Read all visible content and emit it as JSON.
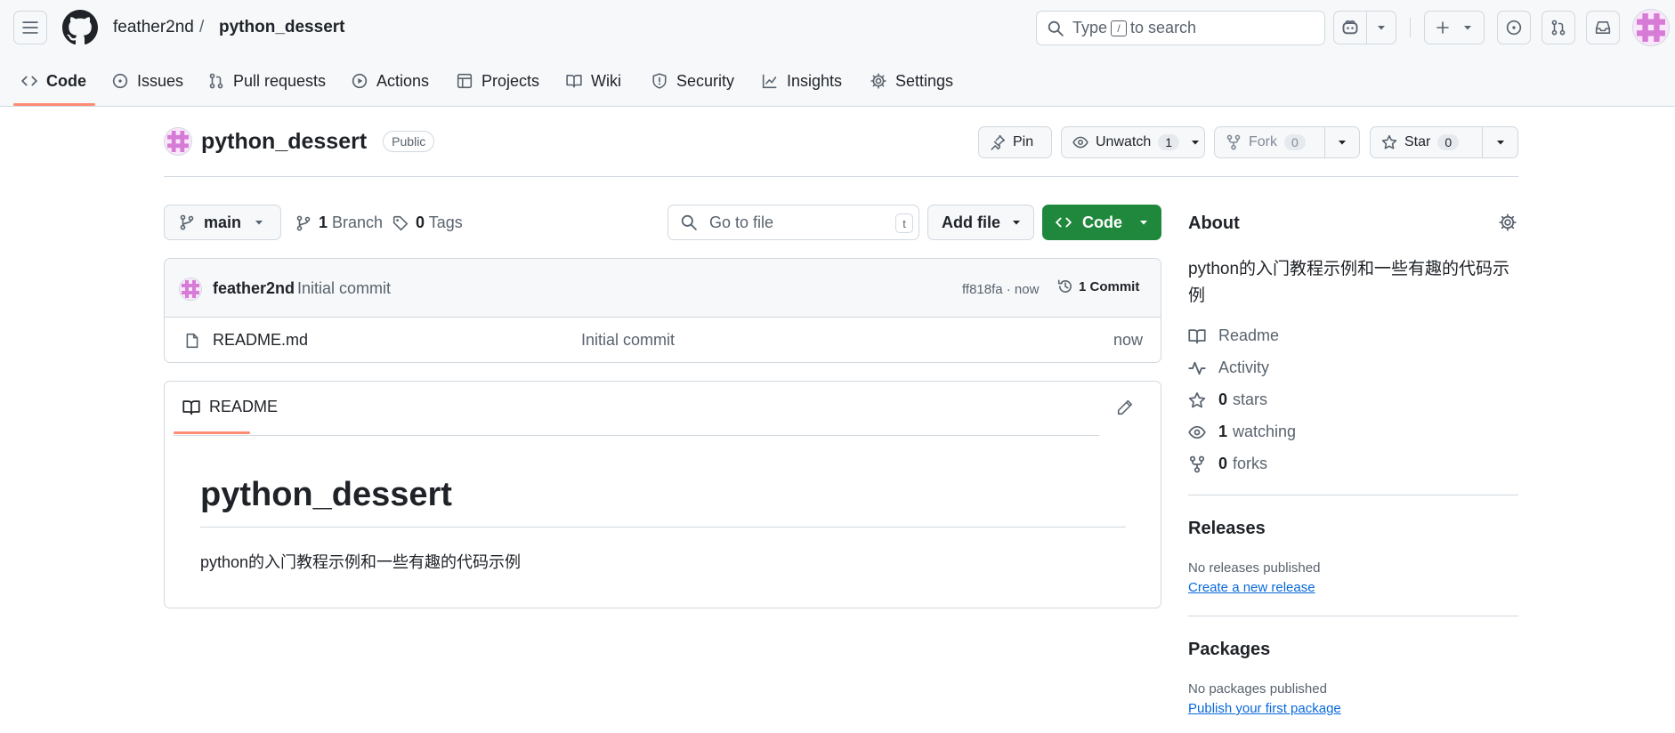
{
  "header": {
    "owner": "feather2nd",
    "separator": "/",
    "repo": "python_dessert",
    "search": {
      "prefix": "Type",
      "key": "/",
      "suffix": "to search"
    }
  },
  "tabs": [
    {
      "label": "Code",
      "icon": "code-icon",
      "active": true
    },
    {
      "label": "Issues",
      "icon": "issue-icon"
    },
    {
      "label": "Pull requests",
      "icon": "pull-request-icon"
    },
    {
      "label": "Actions",
      "icon": "play-icon"
    },
    {
      "label": "Projects",
      "icon": "table-icon"
    },
    {
      "label": "Wiki",
      "icon": "book-icon"
    },
    {
      "label": "Security",
      "icon": "shield-icon"
    },
    {
      "label": "Insights",
      "icon": "graph-icon"
    },
    {
      "label": "Settings",
      "icon": "gear-icon"
    }
  ],
  "repo_header": {
    "name": "python_dessert",
    "visibility": "Public",
    "pin": "Pin",
    "unwatch": "Unwatch",
    "watch_count": "1",
    "fork": "Fork",
    "fork_count": "0",
    "star": "Star",
    "star_count": "0"
  },
  "toolbar": {
    "branch": "main",
    "branch_count": "1",
    "branch_label": "Branch",
    "tag_count": "0",
    "tag_label": "Tags",
    "goto_placeholder": "Go to file",
    "goto_key": "t",
    "add_file": "Add file",
    "code": "Code"
  },
  "commit": {
    "author": "feather2nd",
    "message": "Initial commit",
    "hash_time": "ff818fa · now",
    "commits": "1 Commit"
  },
  "files": [
    {
      "name": "README.md",
      "message": "Initial commit",
      "time": "now"
    }
  ],
  "readme": {
    "tab": "README",
    "title": "python_dessert",
    "body": "python的入门教程示例和一些有趣的代码示例"
  },
  "sidebar": {
    "about_title": "About",
    "description": "python的入门教程示例和一些有趣的代码示例",
    "readme": "Readme",
    "activity": "Activity",
    "stars_count": "0",
    "stars_label": "stars",
    "watching_count": "1",
    "watching_label": "watching",
    "forks_count": "0",
    "forks_label": "forks",
    "releases_title": "Releases",
    "no_releases": "No releases published",
    "create_release": "Create a new release",
    "packages_title": "Packages",
    "no_packages": "No packages published",
    "publish_package": "Publish your first package"
  },
  "colors": {
    "accent_green": "#1f883d",
    "tab_underline": "#fd8c73",
    "link": "#0969da"
  }
}
